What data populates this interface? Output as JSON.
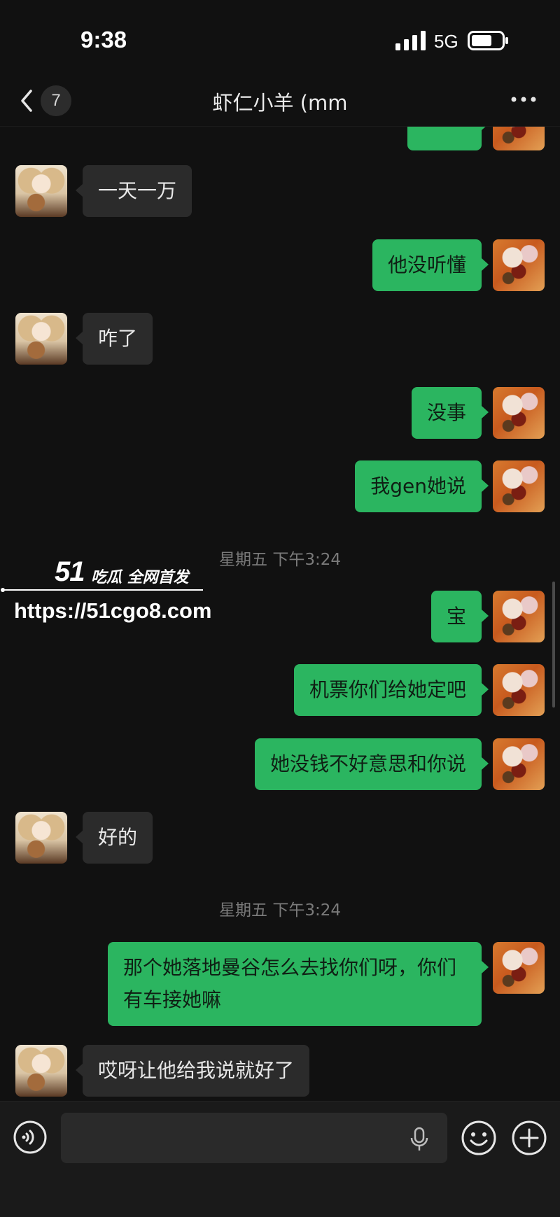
{
  "status_bar": {
    "time": "9:38",
    "network": "5G",
    "icons": [
      "signal-icon",
      "battery-icon"
    ]
  },
  "header": {
    "back_icon": "chevron-left-icon",
    "unread_count": "7",
    "title": "虾仁小羊 (mm",
    "more_icon": "more-dots-icon"
  },
  "messages": [
    {
      "sender": "self",
      "text": ""
    },
    {
      "sender": "other",
      "text": "一天一万"
    },
    {
      "sender": "self",
      "text": "他没听懂"
    },
    {
      "sender": "other",
      "text": "咋了"
    },
    {
      "sender": "self",
      "text": "没事"
    },
    {
      "sender": "self",
      "text": "我gen她说"
    },
    {
      "timestamp": "星期五 下午3:24"
    },
    {
      "sender": "self",
      "text": "宝"
    },
    {
      "sender": "self",
      "text": "机票你们给她定吧"
    },
    {
      "sender": "self",
      "text": "她没钱不好意思和你说"
    },
    {
      "sender": "other",
      "text": "好的"
    },
    {
      "timestamp": "星期五 下午3:24"
    },
    {
      "sender": "self",
      "text": "那个她落地曼谷怎么去找你们呀，你们有车接她嘛"
    },
    {
      "sender": "other",
      "text": "哎呀让他给我说就好了"
    }
  ],
  "watermark": {
    "brand": "51",
    "tag": "吃瓜 全网首发",
    "url": "https://51cgo8.com"
  },
  "input_bar": {
    "voice_icon": "voice-icon",
    "placeholder": "",
    "mic_icon": "microphone-icon",
    "emoji_icon": "emoji-icon",
    "plus_icon": "plus-icon"
  },
  "colors": {
    "background": "#111111",
    "self_bubble": "#2bb560",
    "other_bubble": "#2b2b2b",
    "timestamp": "#7a7a7a"
  }
}
